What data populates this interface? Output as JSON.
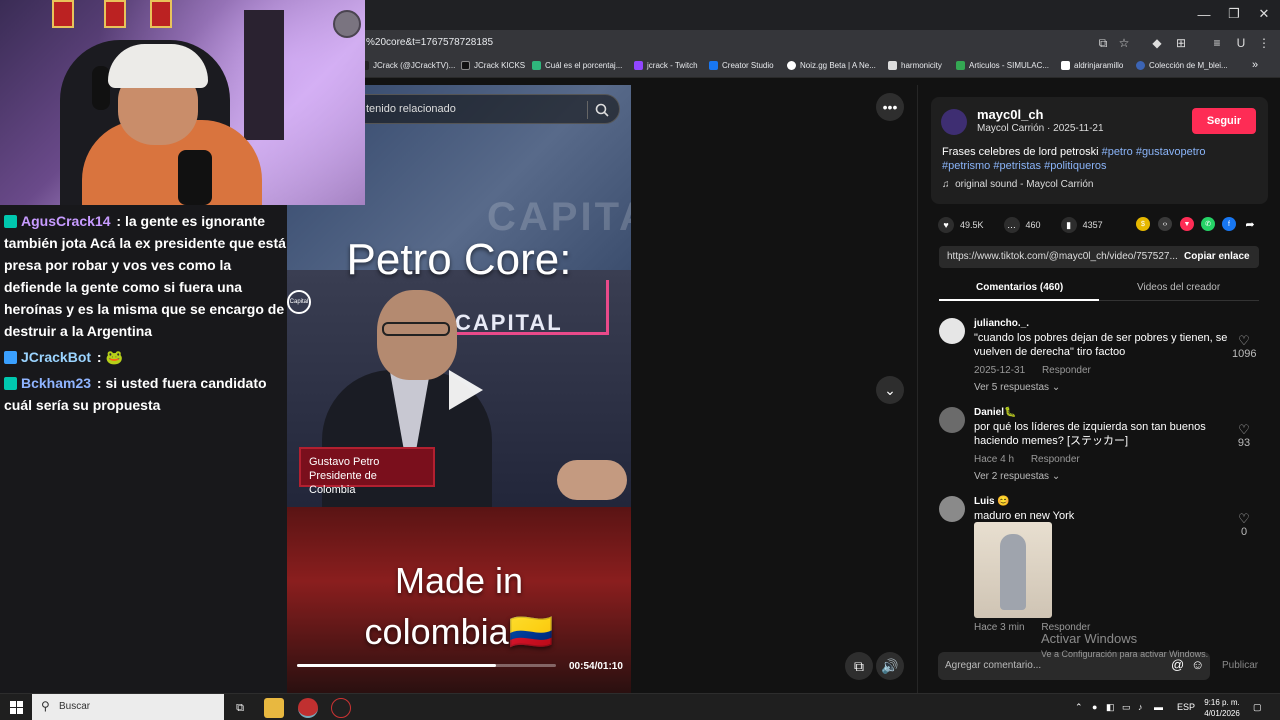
{
  "browser": {
    "url": "%20core&t=1767578728185",
    "bookmarks": [
      "JCrack (@JCrackTV)...",
      "JCrack KICKS",
      "Cuál es el porcentaj...",
      "jcrack - Twitch",
      "Creator Studio",
      "Noiz.gg Beta | A Ne...",
      "harmonicity",
      "Articulos - SIMULAC...",
      "aldrinjaramillo",
      "Colección de M_blei..."
    ],
    "more_bookmarks": "»"
  },
  "video": {
    "related_search_placeholder": "tenido relacionado",
    "caption_top": "Petro Core:",
    "capital_text": "CAPITAL",
    "capital_logo_text": "Capital",
    "lower_third_name": "Gustavo Petro",
    "lower_third_role": "Presidente de Colombia",
    "caption_bottom_line1": "Made in",
    "caption_bottom_line2": "colombia🇨🇴",
    "time": "00:54/01:10",
    "progress": 0.77
  },
  "author_card": {
    "handle": "mayc0l_ch",
    "byline": "Maycol Carrión · 2025-11-21",
    "follow_label": "Seguir",
    "description_text": "Frases celebres de lord petroski ",
    "hashtags_line1": "#petro #gustavopetro",
    "hashtags_line2": "#petrismo #petristas #politiqueros",
    "sound": "original sound - Maycol Carrión"
  },
  "stats": {
    "likes": "49.5K",
    "comments": "460",
    "saves": "4357"
  },
  "link": {
    "url": "https://www.tiktok.com/@mayc0l_ch/video/757527...",
    "copy_label": "Copiar enlace"
  },
  "tabs": {
    "comments": "Comentarios (460)",
    "creator_videos": "Videos del creador"
  },
  "comments": [
    {
      "user": "juliancho._.",
      "text": "\"cuando los pobres dejan de ser pobres y tienen, se vuelven de derecha\" tiro factoo",
      "date": "2025-12-31",
      "reply": "Responder",
      "replies": "Ver 5 respuestas ⌄",
      "likes": "1096"
    },
    {
      "user": "Daniel🐛",
      "text": "por qué los líderes de izquierda son tan buenos haciendo memes? [ステッカー]",
      "date": "Hace 4 h",
      "reply": "Responder",
      "replies": "Ver 2 respuestas ⌄",
      "likes": "93"
    },
    {
      "user": "Luis 😊",
      "text": "maduro en new York",
      "date": "Hace 3 min",
      "reply": "Responder",
      "likes": "0"
    }
  ],
  "comment_input": {
    "placeholder": "Agregar comentario...",
    "publish": "Publicar"
  },
  "windows_activation": {
    "title": "Activar Windows",
    "subtitle": "Ve a Configuración para activar Windows."
  },
  "chat": [
    {
      "user": "AgusCrack14",
      "color": "#c79bff",
      "sep": " : ",
      "text": "la gente es ignorante también jota Acá la ex presidente que está presa por robar y vos ves como la defiende la gente como si fuera una heroínas y es la misma que se encargo de destruir a la Argentina"
    },
    {
      "user": "JCrackBot",
      "color": "#9bd4ff",
      "sep": " : ",
      "text": "🐸"
    },
    {
      "user": "Bckham23",
      "color": "#8fb4ff",
      "sep": " : ",
      "text": "si usted fuera candidato cuál sería su propuesta"
    }
  ],
  "taskbar": {
    "search_placeholder": "Buscar",
    "lang": "ESP",
    "time": "9:16 p. m.",
    "date": "4/01/2026"
  },
  "colors": {
    "follow": "#fe2c55",
    "hashtag": "#8ab4f8",
    "chat_bg": "#18181b"
  }
}
